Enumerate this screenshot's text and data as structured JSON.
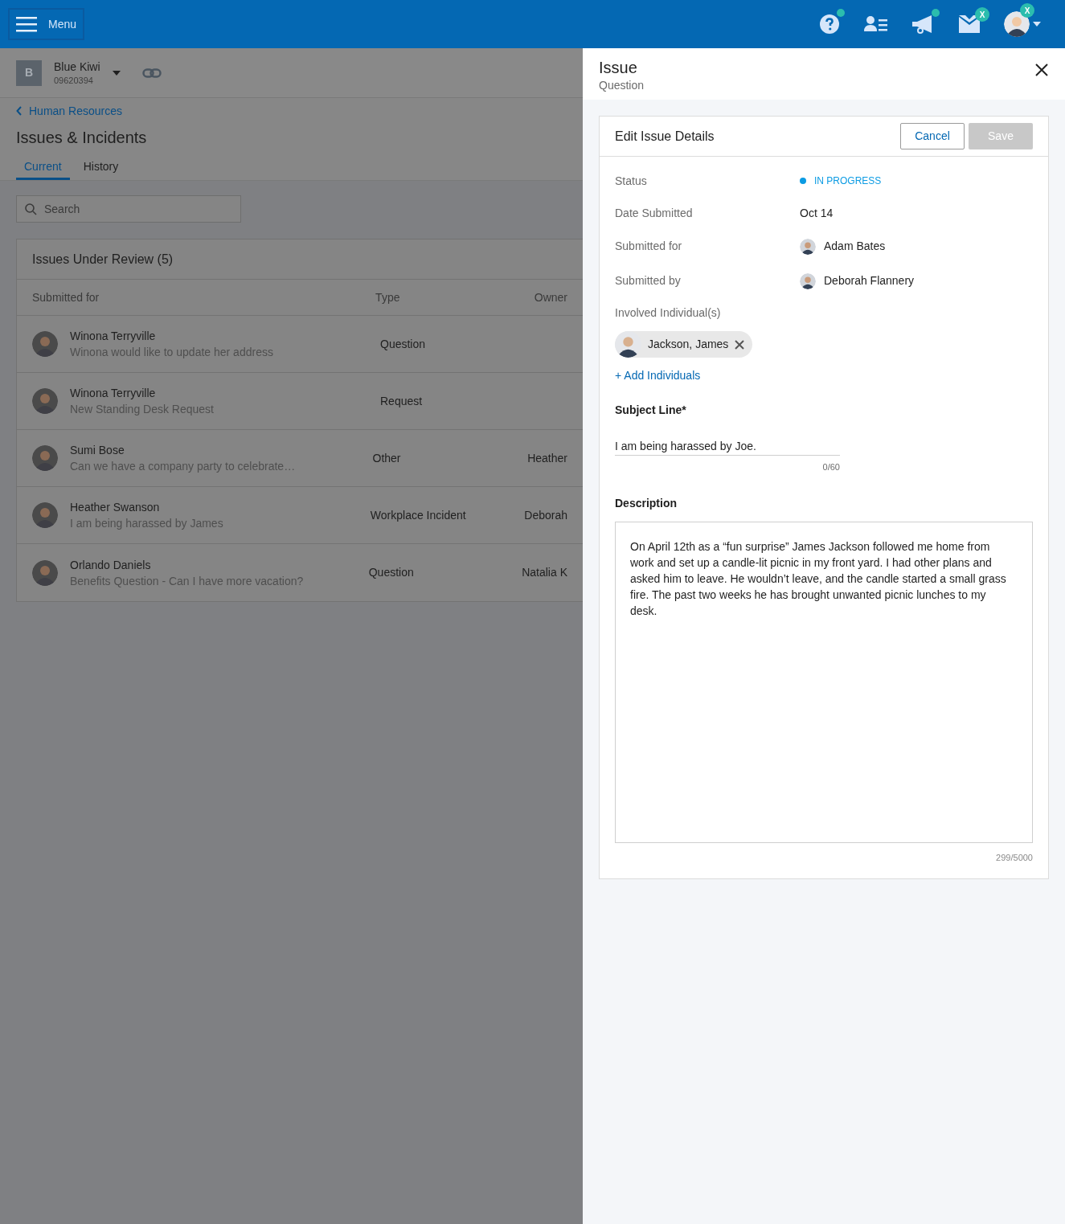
{
  "top_bar": {
    "menu_button": "Menu",
    "icons": [
      {
        "kind": "help",
        "dot": true
      },
      {
        "kind": "contacts",
        "dot": false
      },
      {
        "kind": "megaphone",
        "dot": true
      },
      {
        "kind": "mail",
        "dot": false,
        "badge": "X"
      }
    ],
    "account": {
      "badge": "X"
    }
  },
  "company": {
    "initial": "B",
    "name": "Blue Kiwi",
    "number": "09620394"
  },
  "breadcrumb": "Human Resources",
  "page_title": "Issues & Incidents",
  "tabs": [
    {
      "label": "Current",
      "selected": true
    },
    {
      "label": "History",
      "selected": false
    }
  ],
  "search": {
    "placeholder": "Search"
  },
  "table": {
    "title": "Issues Under Review (5)",
    "columns": [
      "Submitted for",
      "Type",
      "Owner"
    ],
    "rows": [
      {
        "name": "Winona Terryville",
        "summary": "Winona would like to update her address",
        "type": "Question"
      },
      {
        "name": "Winona Terryville",
        "summary": "New Standing Desk Request",
        "type": "Request"
      },
      {
        "name": "Sumi Bose",
        "summary": "Can we have a company party to celebrate…",
        "type": "Other",
        "owner": "Heather"
      },
      {
        "name": "Heather Swanson",
        "summary": "I am being harassed by James",
        "type": "Workplace Incident",
        "owner": "Deborah"
      },
      {
        "name": "Orlando Daniels",
        "summary": "Benefits Question - Can I have more vacation?",
        "type": "Question",
        "owner": "Natalia K"
      }
    ]
  },
  "panel": {
    "title": "Issue",
    "subtitle": "Question",
    "card": {
      "title": "Edit Issue Details",
      "cancel": "Cancel",
      "save": {
        "label": "Save",
        "disabled": true
      },
      "fields": [
        {
          "kind": "status",
          "label": "Status",
          "value": "IN PROGRESS"
        },
        {
          "kind": "text",
          "label": "Date Submitted",
          "value": "Oct 14"
        },
        {
          "kind": "person",
          "label": "Submitted for",
          "value": "Adam Bates"
        },
        {
          "kind": "person",
          "label": "Submitted by",
          "value": "Deborah Flannery"
        }
      ],
      "involved": {
        "label": "Involved Individual(s)",
        "chips": [
          "Jackson, James"
        ],
        "add_link": "+ Add Individuals"
      },
      "subject": {
        "label": "Subject Line*",
        "value": "I am being harassed by Joe.",
        "counter": "0/60"
      },
      "description": {
        "label": "Description",
        "value": "On April 12th as a “fun surprise” James Jackson followed me home from work and set up a candle-lit picnic in my front yard. I had other plans and asked him to leave. He wouldn’t leave, and the candle started a small grass fire. The past two weeks he has brought unwanted picnic lunches to my desk.",
        "counter": "299/5000"
      }
    }
  }
}
